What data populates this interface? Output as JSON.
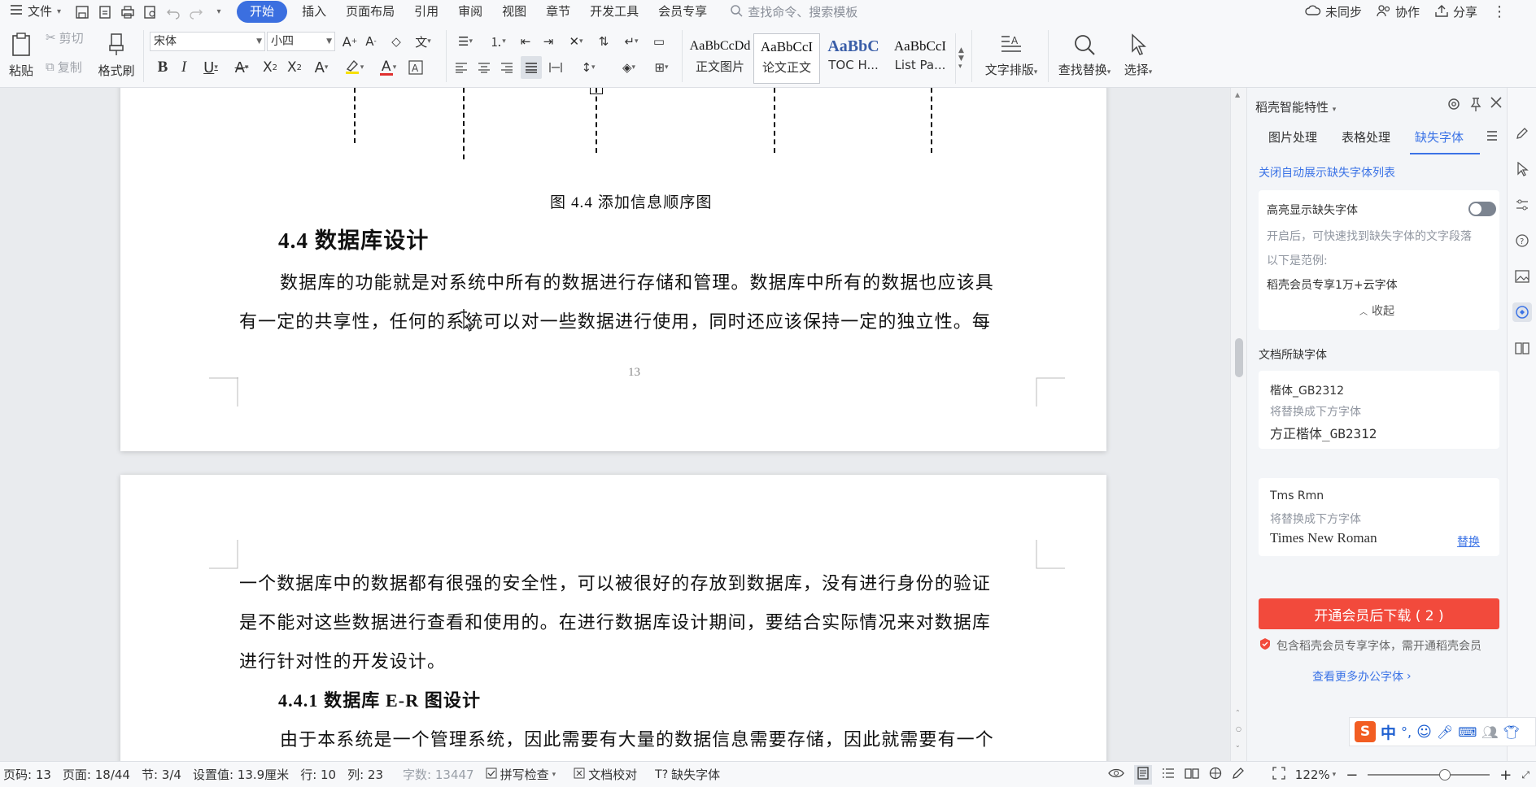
{
  "menubar": {
    "file": "文件",
    "tabs": [
      {
        "label": "开始",
        "active": true
      },
      {
        "label": "插入"
      },
      {
        "label": "页面布局"
      },
      {
        "label": "引用"
      },
      {
        "label": "审阅"
      },
      {
        "label": "视图"
      },
      {
        "label": "章节"
      },
      {
        "label": "开发工具"
      },
      {
        "label": "会员专享"
      }
    ],
    "search_placeholder": "查找命令、搜索模板",
    "right": {
      "sync": "未同步",
      "collab": "协作",
      "share": "分享"
    }
  },
  "ribbon": {
    "paste": "粘贴",
    "cut": "剪切",
    "copy": "复制",
    "format_painter": "格式刷",
    "font_name": "宋体",
    "font_size": "小四",
    "styles": [
      {
        "sample": "AaBbCcDd",
        "name": "正文图片"
      },
      {
        "sample": "AaBbCcI",
        "name": "论文正文"
      },
      {
        "sample": "AaBbC",
        "name": "TOC H..."
      },
      {
        "sample": "AaBbCcI",
        "name": "List Pa..."
      }
    ],
    "text_layout": "文字排版",
    "find_replace": "查找替换",
    "select": "选择"
  },
  "document": {
    "figure_caption": "图 4.4  添加信息顺序图",
    "section_heading": "4.4  数据库设计",
    "para1_line1": "数据库的功能就是对系统中所有的数据进行存储和管理。数据库中所有的数据也应该具",
    "para1_line2": "有一定的共享性，任何的系统可以对一些数据进行使用，同时还应该保持一定的独立性。每",
    "page_number": "13",
    "para2_line1": "一个数据库中的数据都有很强的安全性，可以被很好的存放到数据库，没有进行身份的验证",
    "para2_line2": "是不能对这些数据进行查看和使用的。在进行数据库设计期间，要结合实际情况来对数据库",
    "para2_line3": "进行针对性的开发设计。",
    "subsection_heading": "4.4.1 数据库 E-R 图设计",
    "para3_line1": "由于本系统是一个管理系统，因此需要有大量的数据信息需要存储，因此就需要有一个"
  },
  "panel": {
    "title": "稻壳智能特性",
    "tabs": [
      "图片处理",
      "表格处理",
      "缺失字体"
    ],
    "active_tab": "缺失字体",
    "close_auto": "关闭自动展示缺失字体列表",
    "highlight_title": "高亮显示缺失字体",
    "highlight_desc": "开启后，可快速找到缺失字体的文字段落",
    "example_label": "以下是范例:",
    "example_text": "稻壳会员专享1万+云字体",
    "collapse": "收起",
    "missing_header": "文档所缺字体",
    "missing_fonts": [
      {
        "name": "楷体_GB2312",
        "hint": "将替换成下方字体",
        "replacement": "方正楷体_GB2312",
        "action": ""
      },
      {
        "name": "Tms Rmn",
        "hint": "将替换成下方字体",
        "replacement": "Times New Roman",
        "action": "替换"
      }
    ],
    "download_btn": "开通会员后下载 ( 2 )",
    "vip_note": "包含稻壳会员专享字体，需开通稻壳会员",
    "more_fonts": "查看更多办公字体"
  },
  "statusbar": {
    "page_code": "页码: 13",
    "page": "页面: 18/44",
    "section": "节: 3/4",
    "setting": "设置值: 13.9厘米",
    "row": "行: 10",
    "col": "列: 23",
    "word_count": "字数: 13447",
    "spell_check": "拼写检查",
    "proofread": "文档校对",
    "missing_font": "缺失字体",
    "zoom": "122%"
  },
  "ime": {
    "lang": "中"
  },
  "colors": {
    "accent": "#3b73e6",
    "danger": "#f24a3c",
    "tab_active_bg": "#3b6fe0"
  }
}
